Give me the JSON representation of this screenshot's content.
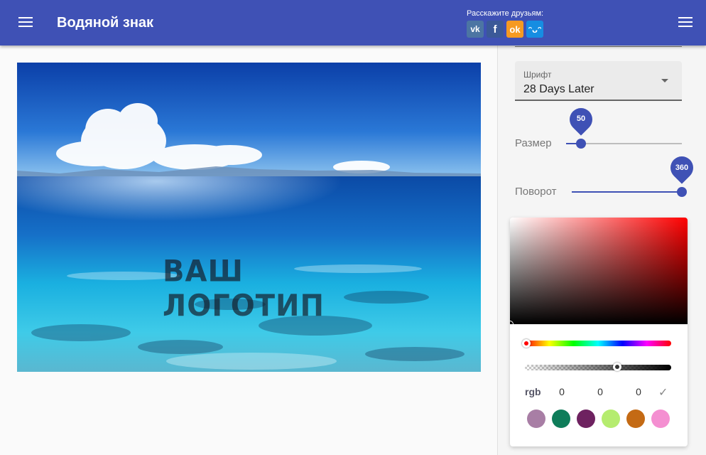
{
  "appbar": {
    "title": "Водяной знак",
    "share_label": "Расскажите друзьям:",
    "social": [
      {
        "name": "vk",
        "glyph": "vk",
        "color": "#4c75a3"
      },
      {
        "name": "facebook",
        "glyph": "f",
        "color": "#3b5998"
      },
      {
        "name": "odnoklassniki",
        "glyph": "ok",
        "color": "#f59a22"
      },
      {
        "name": "mailru-moymir",
        "glyph": "ᵔᴗᵔ",
        "color": "#168de2"
      }
    ]
  },
  "canvas": {
    "watermark_text": "ВАШ ЛОГОТИП"
  },
  "controls": {
    "font": {
      "label": "Шрифт",
      "value": "28 Days Later"
    },
    "size": {
      "label": "Размер",
      "value": "50"
    },
    "rotation": {
      "label": "Поворот",
      "value": "360"
    }
  },
  "color_picker": {
    "mode_label": "rgb",
    "r": "0",
    "g": "0",
    "b": "0",
    "hue": 0,
    "alpha_level": 0.62,
    "swatches": [
      "#a87ea5",
      "#0f7d5a",
      "#6e2260",
      "#b5ec6f",
      "#c46a14",
      "#f48fd1"
    ]
  },
  "colors": {
    "primary": "#3f51b5",
    "panel_bg": "#f5f5f5"
  }
}
